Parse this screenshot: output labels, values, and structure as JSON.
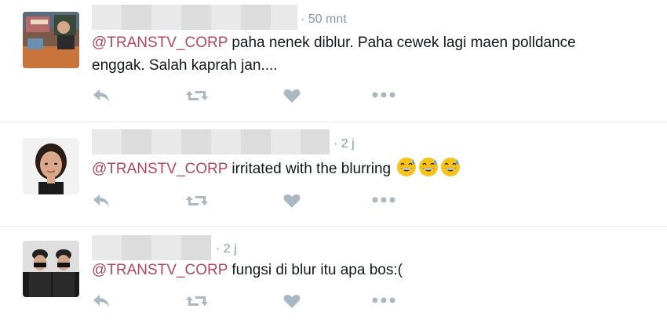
{
  "tweets": [
    {
      "time": "50 mnt",
      "mention": "@TRANSTV_CORP",
      "text_line1": " paha nenek diblur. Paha cewek lagi maen polldance",
      "text_line2": "enggak. Salah kaprah jan...."
    },
    {
      "time": "2 j",
      "mention": "@TRANSTV_CORP",
      "text": " irritated with the blurring ",
      "emojis": [
        "sweat-smile-emoji",
        "sweat-smile-emoji",
        "sweat-smile-emoji"
      ]
    },
    {
      "time": "2 j",
      "mention": "@TRANSTV_CORP",
      "text": " fungsi di blur itu apa bos:("
    }
  ],
  "actions": [
    "reply-icon",
    "retweet-icon",
    "like-icon",
    "more-icon"
  ],
  "colors": {
    "mention": "#b0485d",
    "icon": "#aab8c2",
    "timestamp": "#8899a6",
    "divider": "#e6ecf0"
  }
}
